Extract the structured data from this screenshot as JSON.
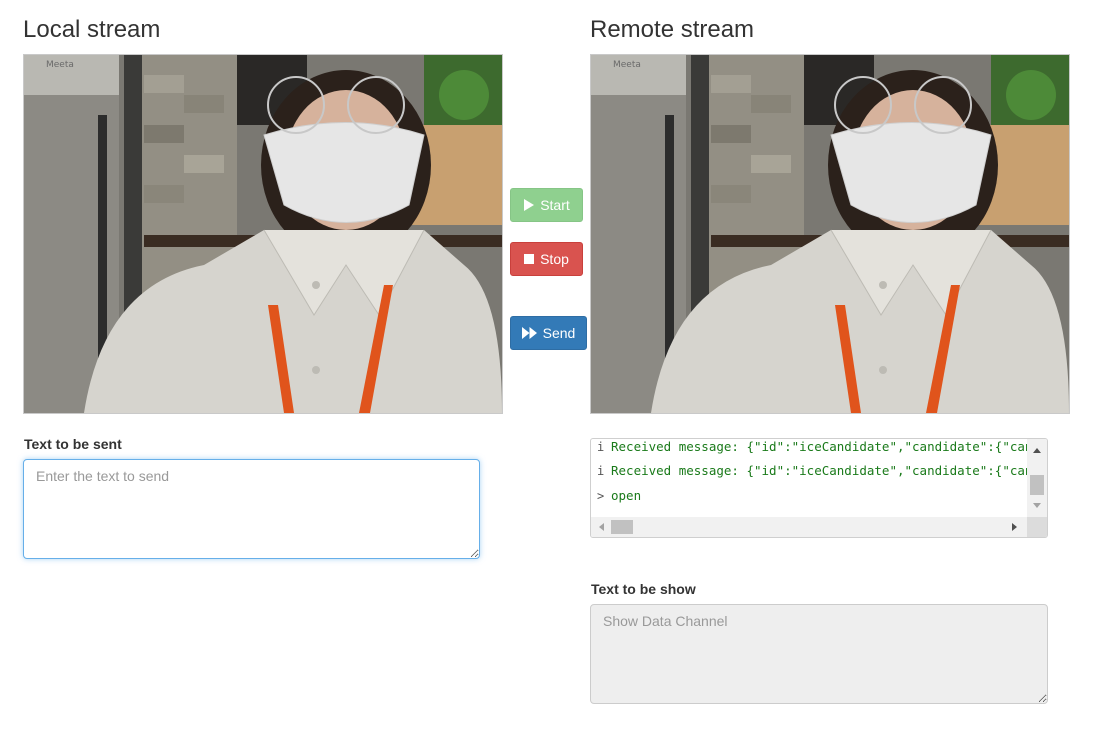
{
  "local": {
    "heading": "Local stream",
    "input_label": "Text to be sent",
    "input_placeholder": "Enter the text to send"
  },
  "remote": {
    "heading": "Remote stream",
    "output_label": "Text to be show",
    "output_placeholder": "Show Data Channel"
  },
  "controls": {
    "start_label": "Start",
    "stop_label": "Stop",
    "send_label": "Send"
  },
  "console": {
    "lines": [
      {
        "icon": "info-icon",
        "prefix": "i",
        "text": "Received message: {\"id\":\"iceCandidate\",\"candidate\":{\"candida"
      },
      {
        "icon": "info-icon",
        "prefix": "i",
        "text": "Received message: {\"id\":\"iceCandidate\",\"candidate\":{\"candida"
      },
      {
        "icon": "prompt-icon",
        "prefix": ">",
        "text": "open"
      }
    ]
  },
  "video_overlay_text": "Meeta",
  "colors": {
    "start": "#8fd08f",
    "stop": "#d9534f",
    "send": "#337ab7",
    "focus": "#66afe9",
    "log_text": "#1a7a1a"
  }
}
